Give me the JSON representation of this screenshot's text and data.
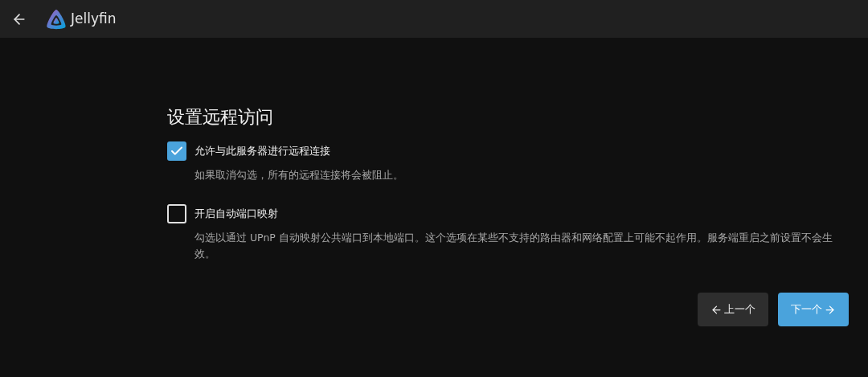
{
  "header": {
    "app_name": "Jellyfin"
  },
  "title": "设置远程访问",
  "options": [
    {
      "label": "允许与此服务器进行远程连接",
      "description": "如果取消勾选，所有的远程连接将会被阻止。",
      "checked": true
    },
    {
      "label": "开启自动端口映射",
      "description": "勾选以通过 UPnP 自动映射公共端口到本地端口。这个选项在某些不支持的路由器和网络配置上可能不起作用。服务端重启之前设置不会生效。",
      "checked": false
    }
  ],
  "buttons": [
    {
      "kind": "back",
      "label": "上一个"
    },
    {
      "kind": "next",
      "label": "下一个"
    }
  ]
}
